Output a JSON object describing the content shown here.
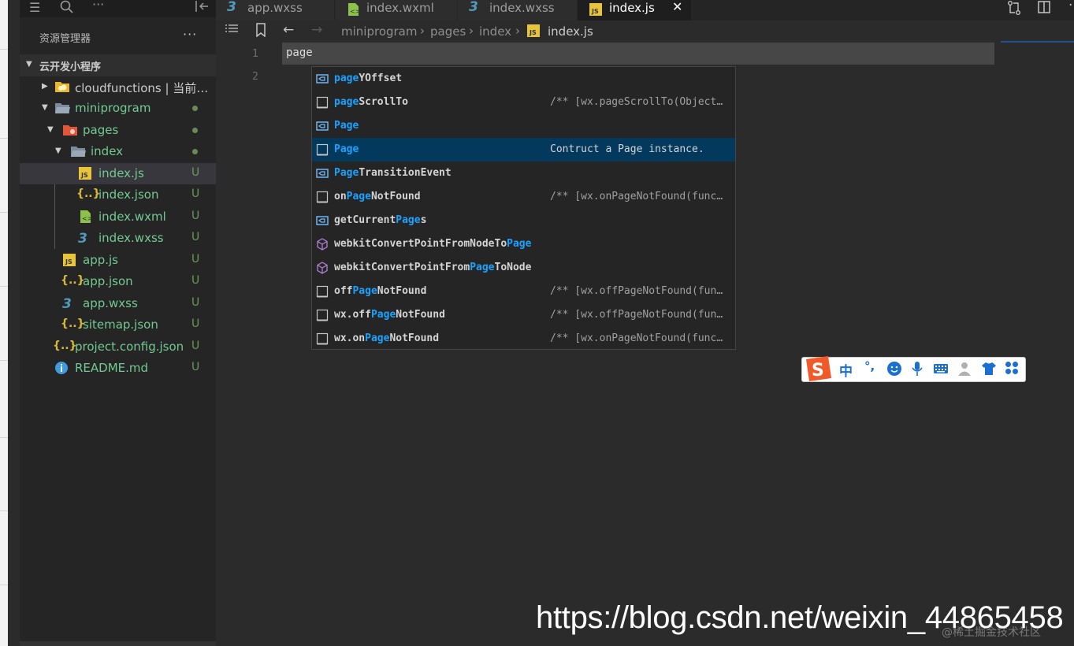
{
  "sidebar": {
    "title": "资源管理器",
    "more": "···",
    "section": "云开发小程序",
    "items": [
      {
        "label": "cloudfunctions | 当前…",
        "status": ""
      },
      {
        "label": "miniprogram",
        "status": ""
      },
      {
        "label": "pages",
        "status": ""
      },
      {
        "label": "index",
        "status": ""
      },
      {
        "label": "index.js",
        "status": "U"
      },
      {
        "label": "index.json",
        "status": "U"
      },
      {
        "label": "index.wxml",
        "status": "U"
      },
      {
        "label": "index.wxss",
        "status": "U"
      },
      {
        "label": "app.js",
        "status": "U"
      },
      {
        "label": "app.json",
        "status": "U"
      },
      {
        "label": "app.wxss",
        "status": "U"
      },
      {
        "label": "sitemap.json",
        "status": "U"
      },
      {
        "label": "project.config.json",
        "status": "U"
      },
      {
        "label": "README.md",
        "status": "U"
      }
    ]
  },
  "tabs": [
    {
      "label": "app.wxss"
    },
    {
      "label": "index.wxml"
    },
    {
      "label": "index.wxss"
    },
    {
      "label": "index.js"
    }
  ],
  "breadcrumb": [
    "miniprogram",
    "pages",
    "index",
    "index.js"
  ],
  "editor": {
    "line_numbers": [
      "1",
      "2"
    ],
    "line1": "page"
  },
  "suggestions": [
    {
      "pre": "",
      "match": "page",
      "post": "YOffset",
      "detail": ""
    },
    {
      "pre": "",
      "match": "page",
      "post": "ScrollTo",
      "detail": "/** [wx.pageScrollTo(Object object)]"
    },
    {
      "pre": "",
      "match": "Page",
      "post": "",
      "detail": ""
    },
    {
      "pre": "",
      "match": "Page",
      "post": "",
      "detail": "Contruct a Page instance."
    },
    {
      "pre": "",
      "match": "Page",
      "post": "TransitionEvent",
      "detail": ""
    },
    {
      "pre": "on",
      "match": "Page",
      "post": "NotFound",
      "detail": "/** [wx.onPageNotFound(function callback)]"
    },
    {
      "pre": "getCurrent",
      "match": "Page",
      "post": "s",
      "detail": ""
    },
    {
      "pre": "webkitConvertPointFromNodeTo",
      "match": "Page",
      "post": "",
      "detail": ""
    },
    {
      "pre": "webkitConvertPointFrom",
      "match": "Page",
      "post": "ToNode",
      "detail": ""
    },
    {
      "pre": "off",
      "match": "Page",
      "post": "NotFound",
      "detail": "/** [wx.offPageNotFound(function callback)]"
    },
    {
      "pre": "wx.off",
      "match": "Page",
      "post": "NotFound",
      "detail": "/** [wx.offPageNotFound(function callback)]"
    },
    {
      "pre": "wx.on",
      "match": "Page",
      "post": "NotFound",
      "detail": "/** [wx.onPageNotFound(function callback)]"
    }
  ],
  "ime": {
    "lang": "中",
    "punct": "°,"
  },
  "watermark": {
    "url": "https://blog.csdn.net/weixin_44865458",
    "community": "@稀土掘金技术社区"
  },
  "colors": {
    "accent": "#18a3ff",
    "js_icon": "#e8c43a",
    "json_icon": "#d7ba3a",
    "wxml_icon": "#8dc149",
    "wxss_icon": "#519aba",
    "untracked": "#6a9955",
    "ime_brand": "#f05a28"
  }
}
